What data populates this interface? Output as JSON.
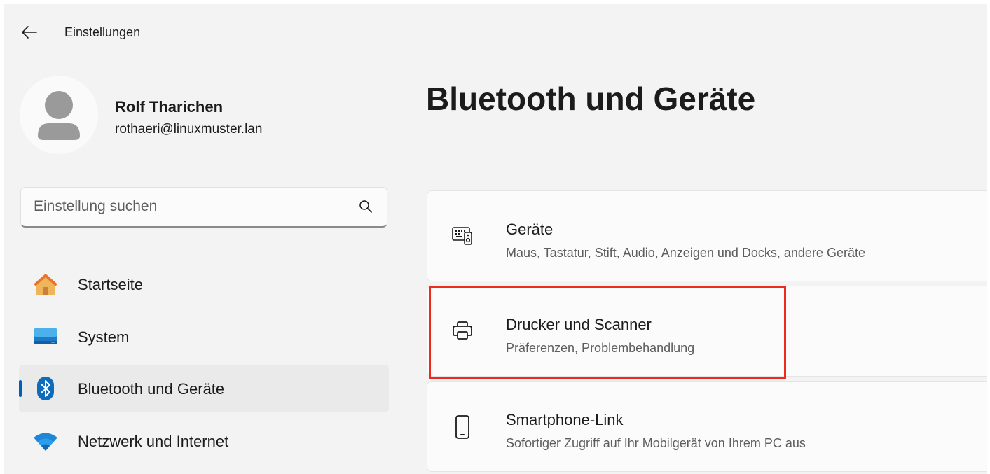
{
  "titlebar": {
    "back_icon": "arrow-left-icon",
    "app_title": "Einstellungen"
  },
  "profile": {
    "avatar_icon": "person-icon",
    "name": "Rolf Tharichen",
    "email": "rothaeri@linuxmuster.lan"
  },
  "search": {
    "placeholder": "Einstellung suchen",
    "value": "",
    "icon": "search-icon"
  },
  "sidebar": {
    "items": [
      {
        "label": "Startseite",
        "icon": "home-icon",
        "selected": false
      },
      {
        "label": "System",
        "icon": "monitor-icon",
        "selected": false
      },
      {
        "label": "Bluetooth und Geräte",
        "icon": "bluetooth-icon",
        "selected": true
      },
      {
        "label": "Netzwerk und Internet",
        "icon": "wifi-icon",
        "selected": false
      }
    ]
  },
  "main": {
    "title": "Bluetooth und Geräte",
    "cards": [
      {
        "title": "Geräte",
        "subtitle": "Maus, Tastatur, Stift, Audio, Anzeigen und Docks, andere Geräte",
        "icon": "devices-icon"
      },
      {
        "title": "Drucker und Scanner",
        "subtitle": "Präferenzen, Problembehandlung",
        "icon": "printer-icon",
        "highlighted": true
      },
      {
        "title": "Smartphone-Link",
        "subtitle": "Sofortiger Zugriff auf Ihr Mobilgerät von Ihrem PC aus",
        "icon": "smartphone-icon"
      }
    ]
  },
  "colors": {
    "accent": "#005fb8",
    "highlight": "#ee2b1b",
    "window_background": "#f3f3f3",
    "card_background": "#fbfbfb"
  }
}
